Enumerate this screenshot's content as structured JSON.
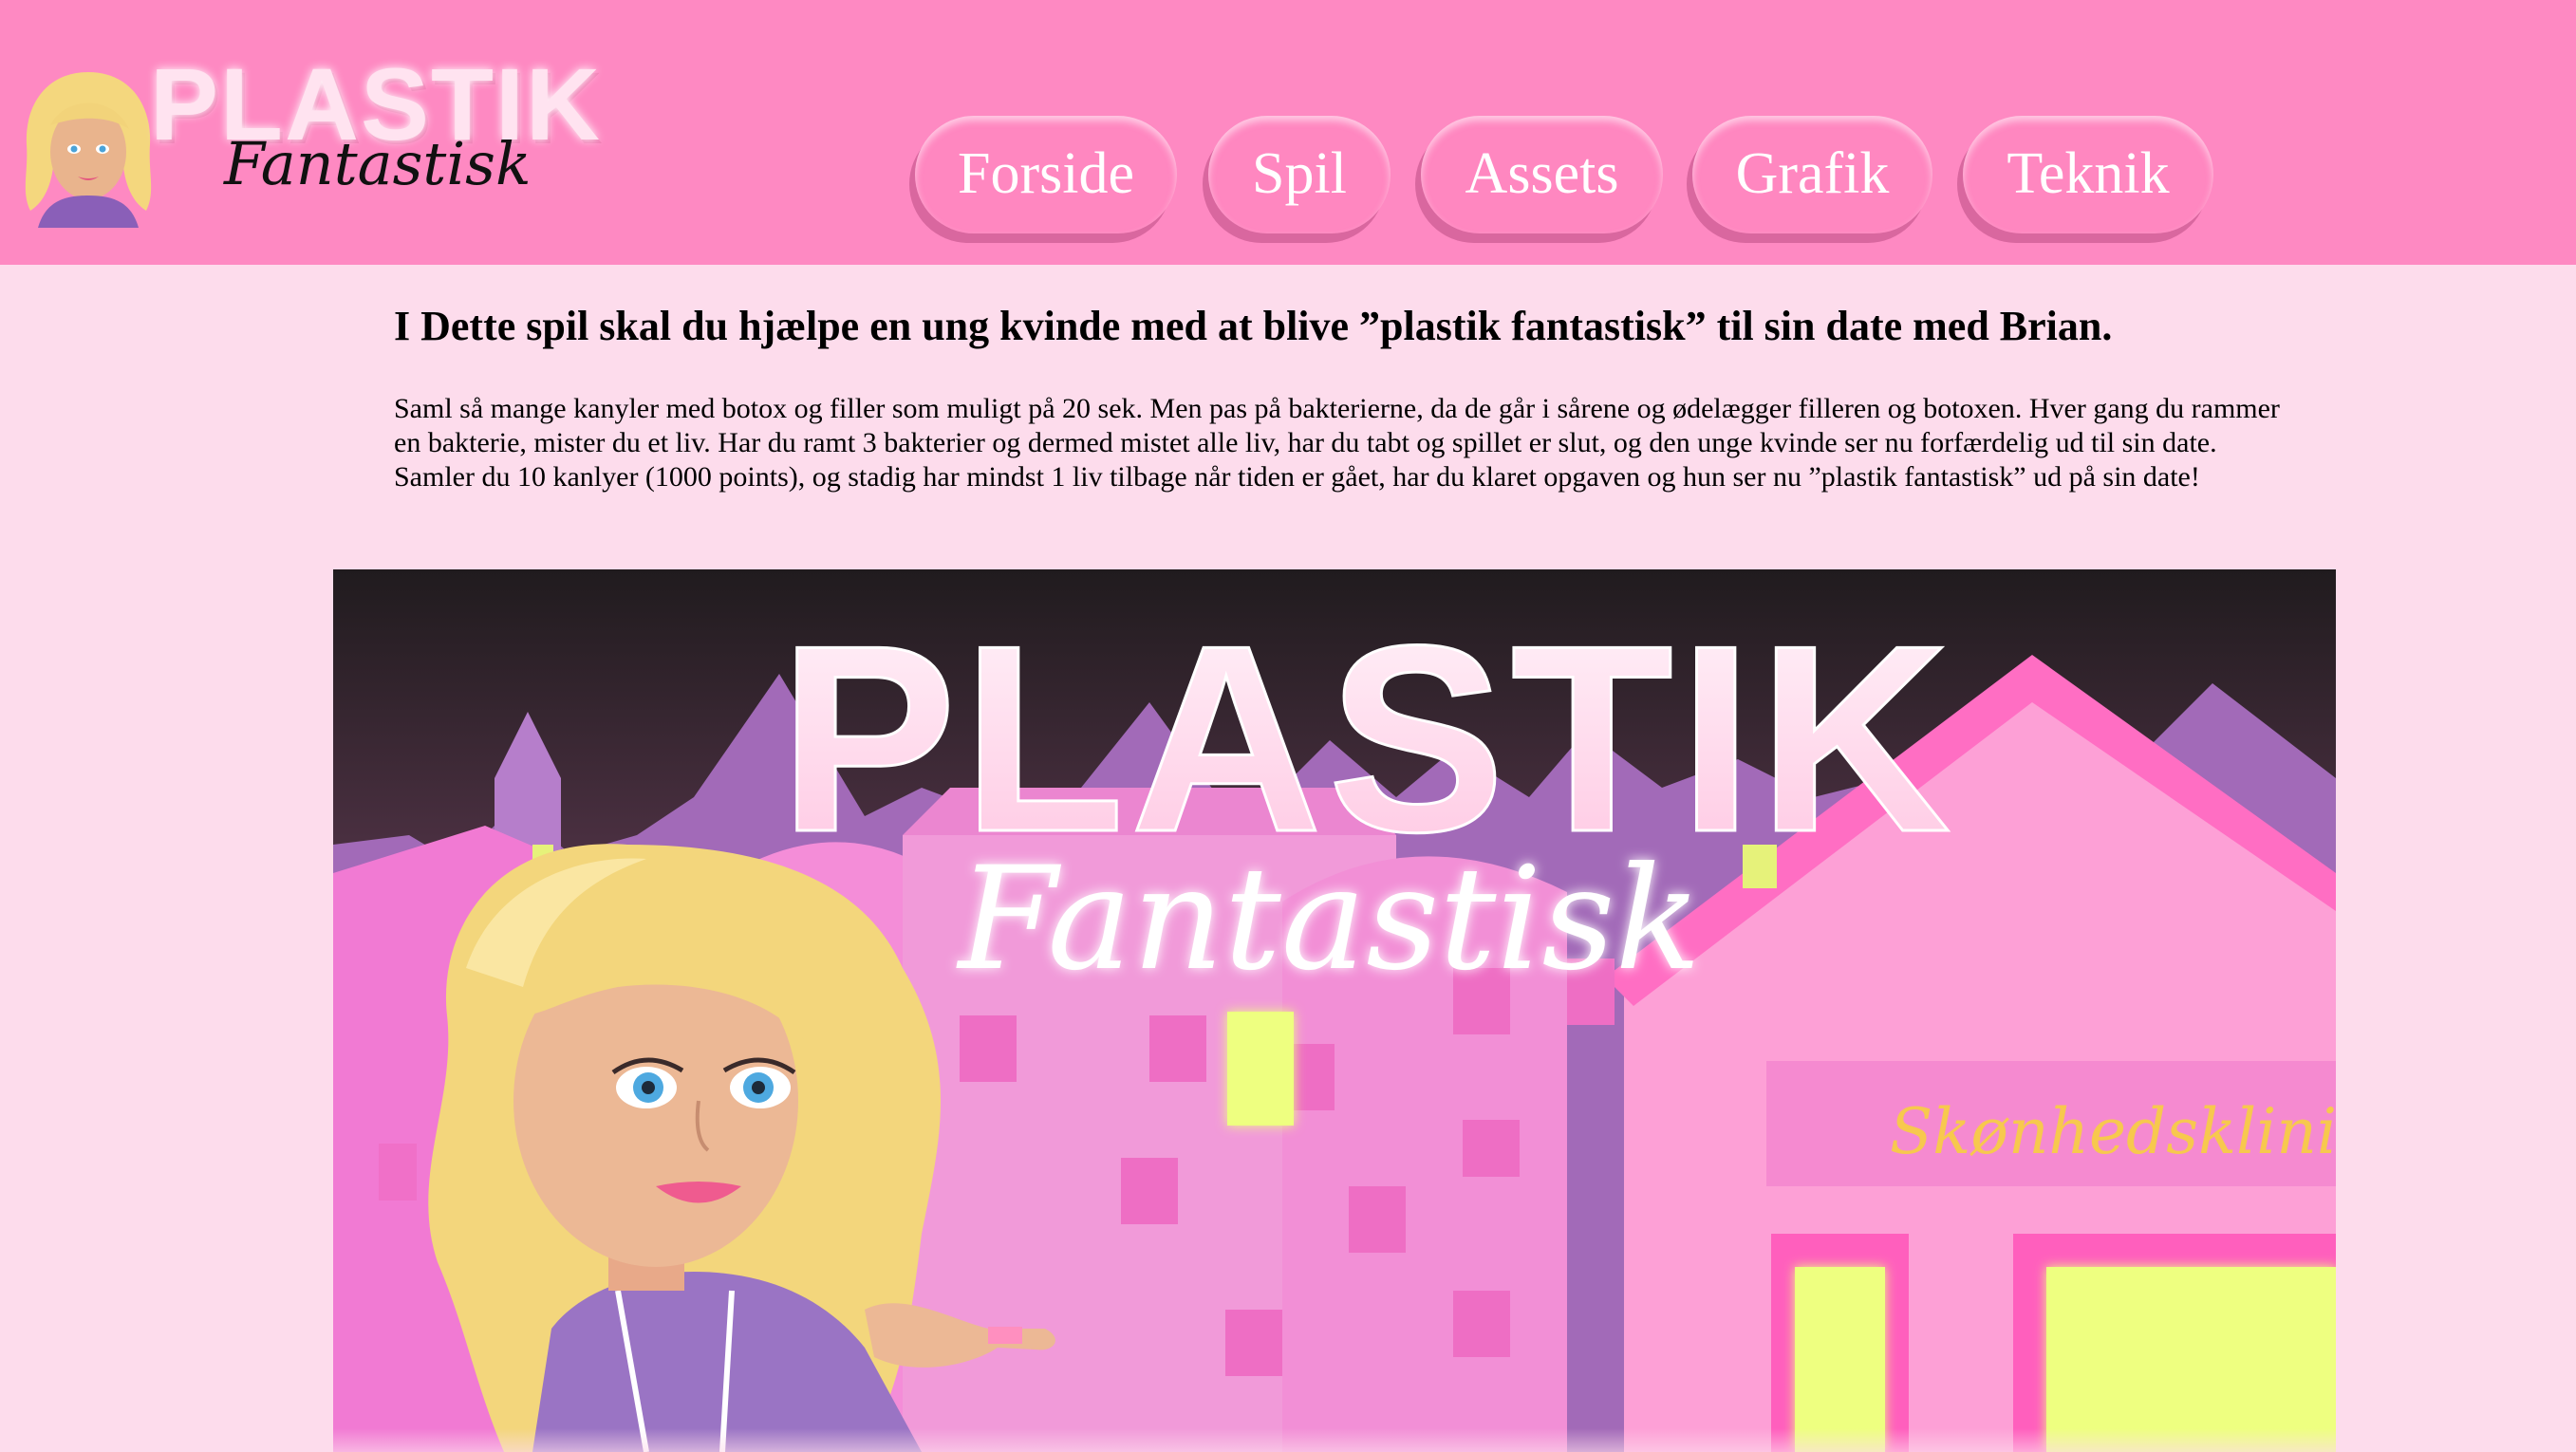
{
  "logo": {
    "title": "PLASTIK",
    "subtitle": "Fantastisk"
  },
  "nav": {
    "items": [
      {
        "label": "Forside"
      },
      {
        "label": "Spil"
      },
      {
        "label": "Assets"
      },
      {
        "label": "Grafik"
      },
      {
        "label": "Teknik"
      }
    ]
  },
  "main": {
    "headline": "I Dette spil skal du hjælpe en ung kvinde med at blive ”plastik fantastisk” til sin date med Brian.",
    "description": "Saml så mange kanyler med botox og filler som muligt på 20 sek. Men pas på bakterierne, da de går i sårene og ødelægger filleren og botoxen. Hver gang du rammer en bakterie, mister du et liv. Har du ramt 3 bakterier og dermed mistet alle liv, har du tabt og spillet er slut, og den unge kvinde ser nu forfærdelig ud til sin date. Samler du 10 kanlyer (1000 points), og stadig har mindst 1 liv tilbage når tiden er gået, har du klaret opgaven og hun ser nu ”plastik fantastisk” ud på sin date!"
  },
  "hero": {
    "title": "PLASTIK",
    "subtitle": "Fantastisk",
    "sign": "Skønhedsklinik"
  },
  "colors": {
    "header": "#fe89c2",
    "page_background": "#fddcec",
    "nav_button": "#ff87c0",
    "window_glow": "#eeff80"
  }
}
